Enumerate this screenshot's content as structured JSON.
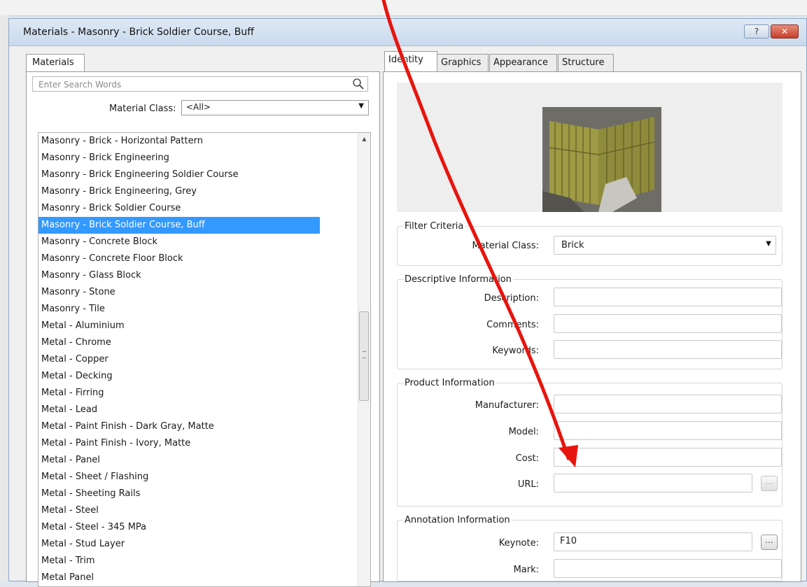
{
  "window": {
    "title": "Materials - Masonry - Brick Soldier Course, Buff",
    "help_label": "?",
    "close_label": "✕"
  },
  "left": {
    "tab_label": "Materials",
    "search_placeholder": "Enter Search Words",
    "class_label": "Material Class:",
    "class_value": "<All>",
    "items": [
      "Masonry - Brick - Horizontal Pattern",
      "Masonry - Brick Engineering",
      "Masonry - Brick Engineering Soldier Course",
      "Masonry - Brick Engineering, Grey",
      "Masonry - Brick Soldier Course",
      "Masonry - Brick Soldier Course, Buff",
      "Masonry - Concrete Block",
      "Masonry - Concrete Floor Block",
      "Masonry - Glass Block",
      "Masonry - Stone",
      "Masonry - Tile",
      "Metal - Aluminium",
      "Metal - Chrome",
      "Metal - Copper",
      "Metal - Decking",
      "Metal - Firring",
      "Metal - Lead",
      "Metal - Paint Finish - Dark Gray, Matte",
      "Metal - Paint Finish - Ivory, Matte",
      "Metal - Panel",
      "Metal - Sheet / Flashing",
      "Metal - Sheeting Rails",
      "Metal - Steel",
      "Metal - Steel - 345 MPa",
      "Metal - Stud Layer",
      "Metal - Trim",
      "Metal Panel"
    ],
    "selected_index": 5
  },
  "tabs": [
    "Identity",
    "Graphics",
    "Appearance",
    "Structure"
  ],
  "filter": {
    "legend": "Filter Criteria",
    "class_label": "Material Class:",
    "class_value": "Brick"
  },
  "descriptive": {
    "legend": "Descriptive Information",
    "description_label": "Description:",
    "comments_label": "Comments:",
    "keywords_label": "Keywords:",
    "description": "",
    "comments": "",
    "keywords": ""
  },
  "product": {
    "legend": "Product Information",
    "manufacturer_label": "Manufacturer:",
    "model_label": "Model:",
    "cost_label": "Cost:",
    "url_label": "URL:",
    "manufacturer": "",
    "model": "",
    "cost": "",
    "url": "",
    "url_browse": "..."
  },
  "annotation": {
    "legend": "Annotation Information",
    "keynote_label": "Keynote:",
    "keynote": "F10",
    "keynote_browse": "...",
    "mark_label": "Mark:",
    "mark": ""
  },
  "colors": {
    "selection": "#3399ff",
    "arrow": "#e8140e",
    "brick": "#9e9a45"
  }
}
